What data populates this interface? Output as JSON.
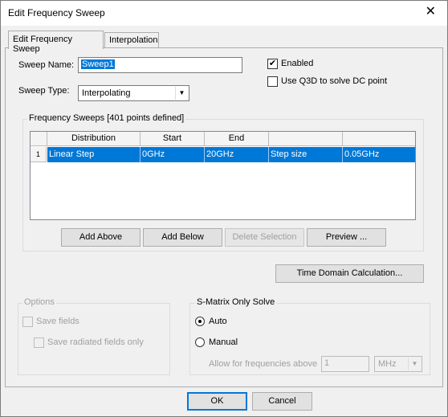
{
  "window": {
    "title": "Edit Frequency Sweep",
    "close_glyph": "✕"
  },
  "tabs": [
    {
      "label": "Edit Frequency Sweep"
    },
    {
      "label": "Interpolation"
    }
  ],
  "sweep": {
    "name_label": "Sweep Name:",
    "name_value": "Sweep1",
    "type_label": "Sweep Type:",
    "type_value": "Interpolating"
  },
  "options_right": {
    "enabled_label": "Enabled",
    "enabled_checked": true,
    "q3d_label": "Use Q3D to solve DC point",
    "q3d_checked": false
  },
  "freq_sweeps": {
    "group_title": "Frequency Sweeps [401 points defined]",
    "columns": [
      "Distribution",
      "Start",
      "End",
      "",
      ""
    ],
    "rows": [
      {
        "index": "1",
        "cells": [
          "Linear Step",
          "0GHz",
          "20GHz",
          "Step size",
          "0.05GHz"
        ]
      }
    ],
    "buttons": {
      "add_above": "Add Above",
      "add_below": "Add Below",
      "delete_selection": "Delete Selection",
      "preview": "Preview ..."
    }
  },
  "time_domain_button": "Time Domain Calculation...",
  "options_group": {
    "title": "Options",
    "save_fields": "Save fields",
    "save_radiated": "Save radiated fields only"
  },
  "smatrix": {
    "title": "S-Matrix Only Solve",
    "auto_label": "Auto",
    "manual_label": "Manual",
    "selected": "Auto",
    "allow_label": "Allow for frequencies above",
    "allow_value": "1",
    "unit_value": "MHz"
  },
  "footer": {
    "ok": "OK",
    "cancel": "Cancel"
  }
}
